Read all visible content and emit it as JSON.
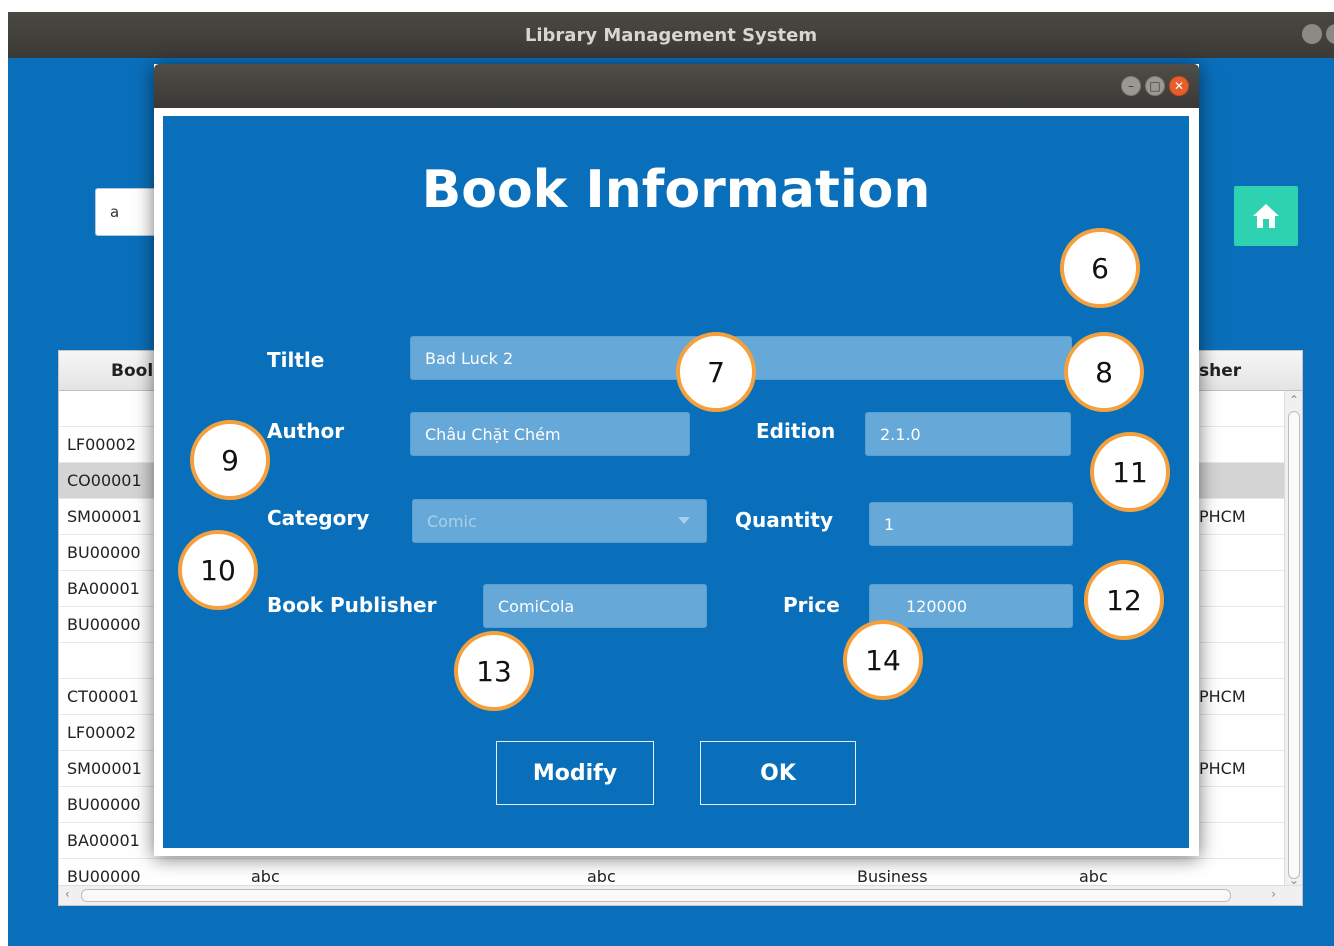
{
  "main_window": {
    "title": "Library Management System",
    "search_value": "a",
    "home_icon": "house-icon"
  },
  "table": {
    "headers": {
      "book": "Bool",
      "publisher": "sher"
    },
    "rows": [
      [
        "",
        "",
        "",
        "",
        "",
        ""
      ],
      [
        "LF00002",
        "",
        "",
        "",
        "",
        ""
      ],
      [
        "CO00001",
        "",
        "",
        "",
        "",
        ""
      ],
      [
        "SM00001",
        "",
        "",
        "",
        "",
        "PHCM"
      ],
      [
        "BU00000",
        "",
        "",
        "",
        "",
        ""
      ],
      [
        "BA00001",
        "",
        "",
        "",
        "",
        ""
      ],
      [
        "BU00000",
        "",
        "",
        "",
        "",
        ""
      ],
      [
        "",
        "",
        "",
        "",
        "",
        ""
      ],
      [
        "CT00001",
        "",
        "",
        "",
        "",
        "PHCM"
      ],
      [
        "LF00002",
        "",
        "",
        "",
        "",
        ""
      ],
      [
        "SM00001",
        "",
        "",
        "",
        "",
        "PHCM"
      ],
      [
        "BU00000",
        "",
        "",
        "",
        "",
        ""
      ],
      [
        "BA00001",
        "",
        "",
        "",
        "",
        ""
      ],
      [
        "BU00000",
        "abc",
        "abc",
        "Business",
        "abc",
        ""
      ]
    ],
    "selected_row": 2
  },
  "dialog": {
    "title": "Book Information",
    "labels": {
      "title": "Tiltle",
      "author": "Author",
      "edition": "Edition",
      "category": "Category",
      "quantity": "Quantity",
      "publisher": "Book Publisher",
      "price": "Price"
    },
    "values": {
      "title": "Bad Luck 2",
      "author": "Châu Chặt Chém",
      "edition": "2.1.0",
      "category": "Comic",
      "quantity": "1",
      "publisher": "ComiCola",
      "price": "120000"
    },
    "buttons": {
      "modify": "Modify",
      "ok": "OK"
    }
  },
  "markers": {
    "m6": "6",
    "m7": "7",
    "m8": "8",
    "m9": "9",
    "m10": "10",
    "m11": "11",
    "m12": "12",
    "m13": "13",
    "m14": "14"
  },
  "colors": {
    "window_blue": "#0a6fba",
    "field_blue": "#66a8d8",
    "home_teal": "#2ed2b0",
    "marker_orange": "#f4a13d",
    "close_orange": "#e85e2b"
  }
}
